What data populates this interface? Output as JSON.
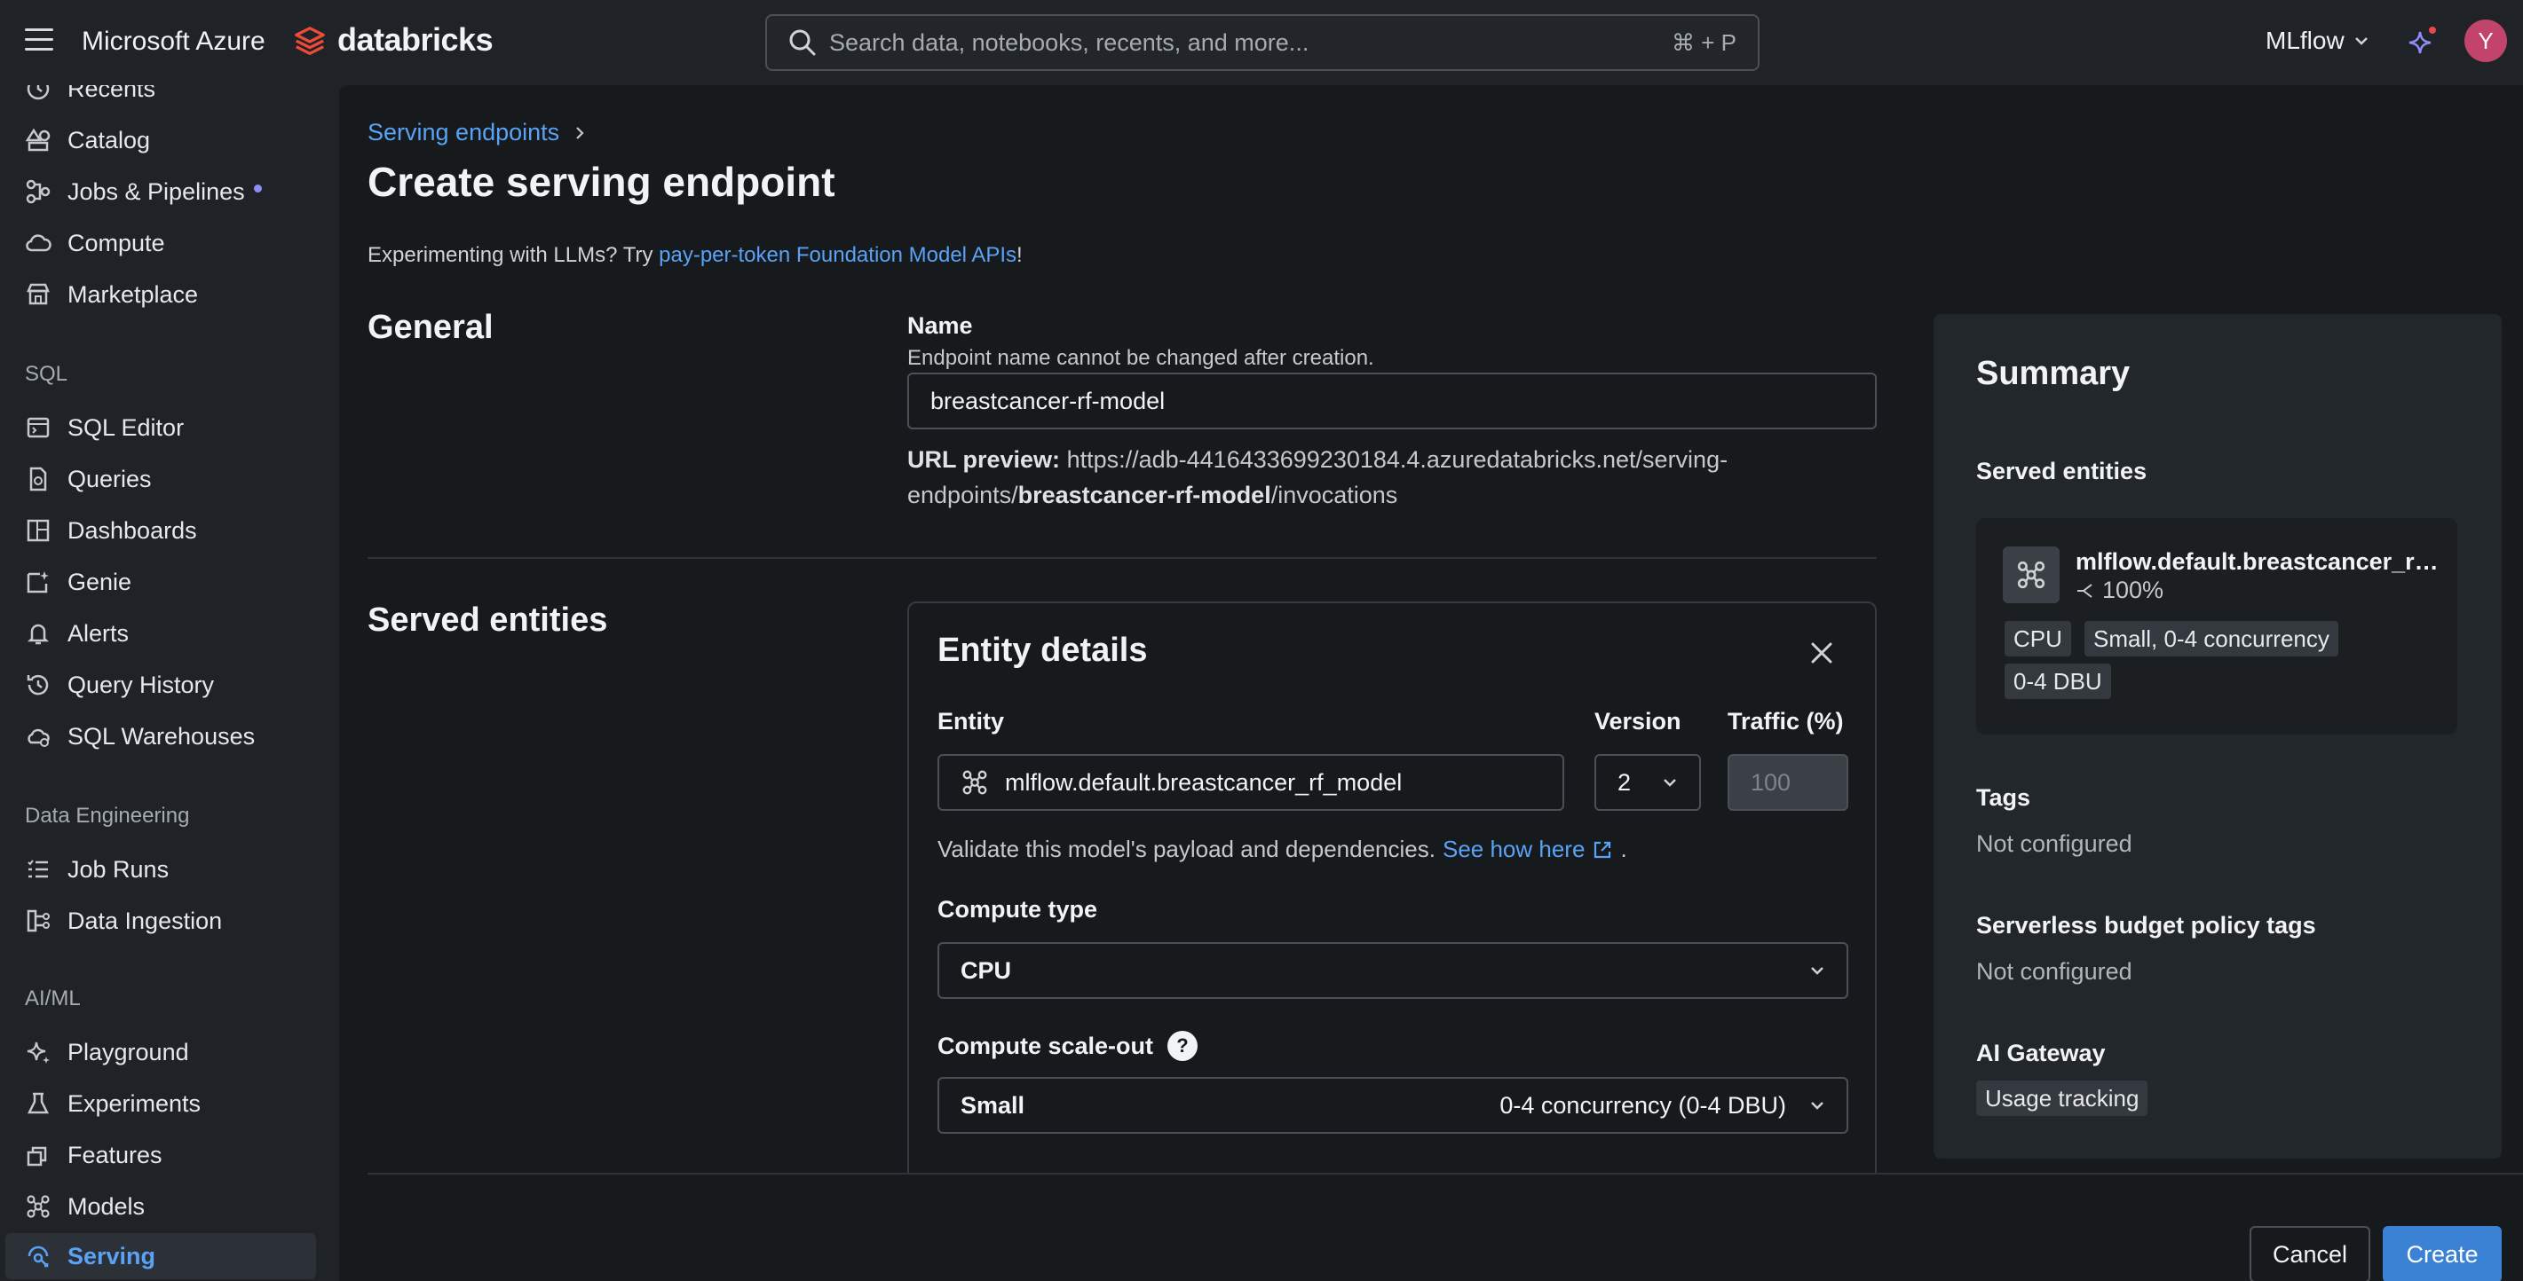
{
  "topbar": {
    "cloud": "Microsoft Azure",
    "brand": "databricks",
    "search_placeholder": "Search data, notebooks, recents, and more...",
    "search_shortcut": "⌘ + P",
    "workspace": "MLflow",
    "avatar_initial": "Y"
  },
  "sidebar": {
    "items_top": [
      {
        "label": "Recents",
        "icon": "clock-icon"
      },
      {
        "label": "Catalog",
        "icon": "catalog-icon"
      },
      {
        "label": "Jobs & Pipelines",
        "icon": "workflow-icon",
        "badge": true
      },
      {
        "label": "Compute",
        "icon": "cloud-icon"
      },
      {
        "label": "Marketplace",
        "icon": "store-icon"
      }
    ],
    "sql_section": "SQL",
    "sql_items": [
      {
        "label": "SQL Editor",
        "icon": "editor-icon"
      },
      {
        "label": "Queries",
        "icon": "query-icon"
      },
      {
        "label": "Dashboards",
        "icon": "dashboard-icon"
      },
      {
        "label": "Genie",
        "icon": "genie-icon"
      },
      {
        "label": "Alerts",
        "icon": "bell-icon"
      },
      {
        "label": "Query History",
        "icon": "history-icon"
      },
      {
        "label": "SQL Warehouses",
        "icon": "warehouse-icon"
      }
    ],
    "de_section": "Data Engineering",
    "de_items": [
      {
        "label": "Job Runs",
        "icon": "list-icon"
      },
      {
        "label": "Data Ingestion",
        "icon": "ingestion-icon"
      }
    ],
    "ml_section": "AI/ML",
    "ml_items": [
      {
        "label": "Playground",
        "icon": "sparkle-icon"
      },
      {
        "label": "Experiments",
        "icon": "flask-icon"
      },
      {
        "label": "Features",
        "icon": "features-icon"
      },
      {
        "label": "Models",
        "icon": "model-icon"
      },
      {
        "label": "Serving",
        "icon": "serving-icon",
        "active": true
      }
    ]
  },
  "main": {
    "breadcrumb": "Serving endpoints",
    "title": "Create serving endpoint",
    "llm_note_prefix": "Experimenting with LLMs? Try ",
    "llm_note_link": "pay-per-token Foundation Model APIs",
    "llm_note_suffix": "!",
    "general": {
      "section_title": "General",
      "name_label": "Name",
      "name_help": "Endpoint name cannot be changed after creation.",
      "name_value": "breastcancer-rf-model",
      "url_label": "URL preview:",
      "url_prefix": "https://adb-4416433699230184.4.azuredatabricks.net/serving-endpoints/",
      "url_endpoint": "breastcancer-rf-model",
      "url_suffix": "/invocations"
    },
    "served_entities": {
      "section_title": "Served entities",
      "card_title": "Entity details",
      "entity_label": "Entity",
      "entity_value": "mlflow.default.breastcancer_rf_model",
      "version_label": "Version",
      "version_value": "2",
      "traffic_label": "Traffic (%)",
      "traffic_value": "100",
      "validate_text": "Validate this model's payload and dependencies.",
      "validate_link": "See how here",
      "compute_type_label": "Compute type",
      "compute_type_value": "CPU",
      "scale_out_label": "Compute scale-out",
      "scale_out_size": "Small",
      "scale_out_detail": "0-4 concurrency (0-4 DBU)"
    }
  },
  "summary": {
    "title": "Summary",
    "served_entities_label": "Served entities",
    "entity_name": "mlflow.default.breastcancer_rf_model",
    "entity_traffic": "100%",
    "tags": [
      "CPU",
      "Small, 0-4 concurrency",
      "0-4 DBU"
    ],
    "tags_label": "Tags",
    "tags_value": "Not configured",
    "budget_label": "Serverless budget policy tags",
    "budget_value": "Not configured",
    "gateway_label": "AI Gateway",
    "gateway_tag": "Usage tracking"
  },
  "footer": {
    "cancel": "Cancel",
    "create": "Create"
  },
  "colors": {
    "accent": "#5aa2f5",
    "primary_button": "#3b82d4",
    "background": "#161a1d",
    "panel": "#22272b"
  }
}
